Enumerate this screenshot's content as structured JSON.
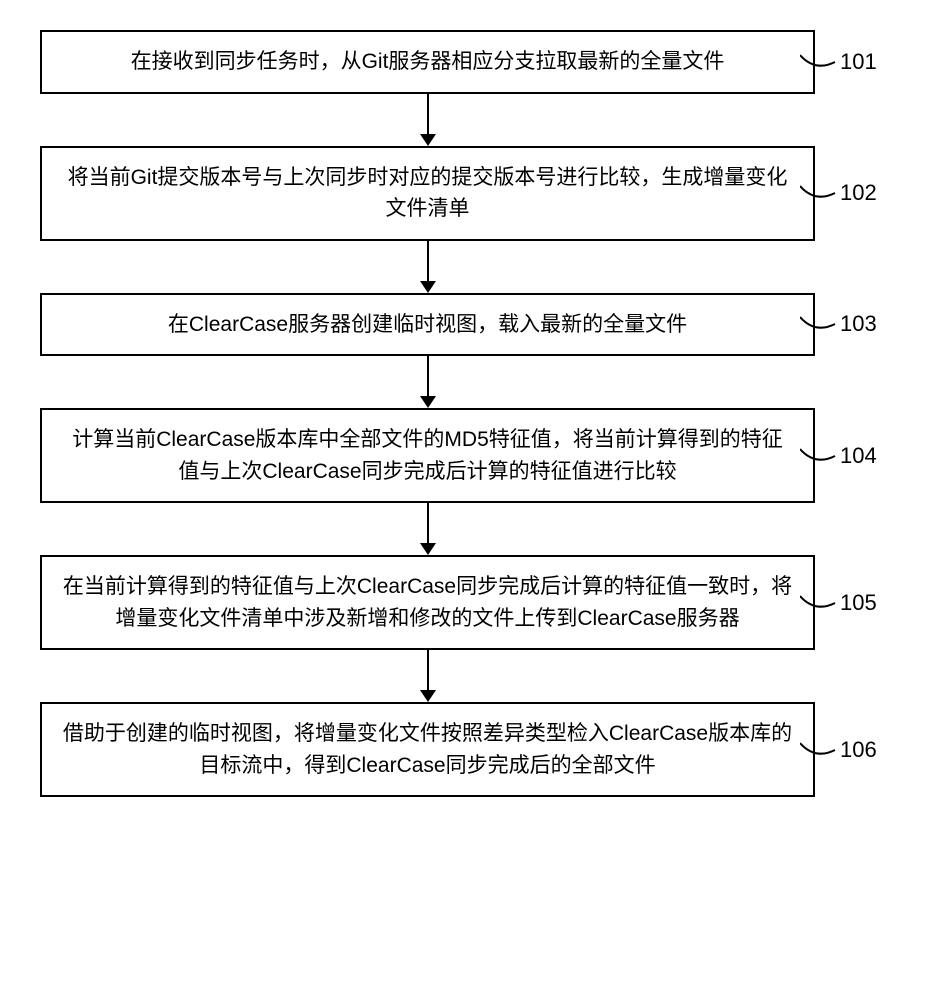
{
  "steps": [
    {
      "number": "101",
      "text": "在接收到同步任务时，从Git服务器相应分支拉取最新的全量文件"
    },
    {
      "number": "102",
      "text": "将当前Git提交版本号与上次同步时对应的提交版本号进行比较，生成增量变化文件清单"
    },
    {
      "number": "103",
      "text": "在ClearCase服务器创建临时视图，载入最新的全量文件"
    },
    {
      "number": "104",
      "text": "计算当前ClearCase版本库中全部文件的MD5特征值，将当前计算得到的特征值与上次ClearCase同步完成后计算的特征值进行比较"
    },
    {
      "number": "105",
      "text": "在当前计算得到的特征值与上次ClearCase同步完成后计算的特征值一致时，将增量变化文件清单中涉及新增和修改的文件上传到ClearCase服务器"
    },
    {
      "number": "106",
      "text": "借助于创建的临时视图，将增量变化文件按照差异类型检入ClearCase版本库的目标流中，得到ClearCase同步完成后的全部文件"
    }
  ]
}
